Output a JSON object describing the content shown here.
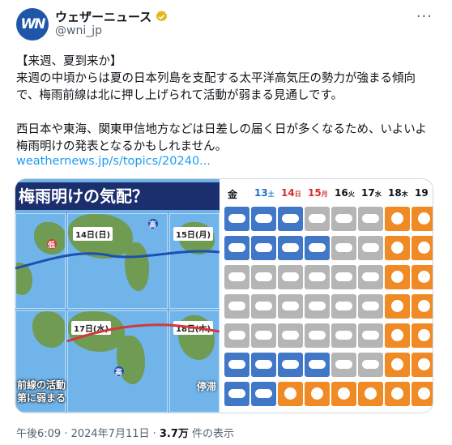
{
  "account": {
    "display_name": "ウェザーニュース",
    "handle": "@wni_jp",
    "avatar_text": "WN",
    "more_label": "···"
  },
  "post": {
    "text": "【来週、夏到来か】\n来週の中頃からは夏の日本列島を支配する太平洋高気圧の勢力が強まる傾向で、梅雨前線は北に押し上げられて活動が弱まる見通しです。\n\n西日本や東海、関東甲信地方などは日差しの届く日が多くなるため、いよいよ梅雨明けの発表となるかもしれません。",
    "link": "weathernews.jp/s/topics/20240..."
  },
  "media": {
    "left": {
      "headline": "梅雨明けの気配？",
      "maps": [
        {
          "date": "14日(日)"
        },
        {
          "date": "15日(月)"
        },
        {
          "date": "17日(水)"
        },
        {
          "date": "18日(木)"
        }
      ],
      "pressure_high": "高",
      "pressure_low": "低",
      "caption_line1": "前線の活動",
      "caption_line2": "第に弱まる",
      "stagnant": "停滞"
    },
    "right": {
      "days": [
        {
          "num": "金",
          "dow": "",
          "color": "#0f1419"
        },
        {
          "num": "13",
          "dow": "土",
          "color": "#1f6fc5"
        },
        {
          "num": "14",
          "dow": "日",
          "color": "#d0312d"
        },
        {
          "num": "15",
          "dow": "月",
          "color": "#d0312d"
        },
        {
          "num": "16",
          "dow": "火",
          "color": "#0f1419"
        },
        {
          "num": "17",
          "dow": "水",
          "color": "#0f1419"
        },
        {
          "num": "18",
          "dow": "木",
          "color": "#0f1419"
        },
        {
          "num": "19",
          "dow": "",
          "color": "#0f1419"
        }
      ],
      "rows": [
        [
          "rain",
          "rain",
          "rain",
          "cloudy",
          "cloudy",
          "cloudy",
          "sunny",
          "sunny"
        ],
        [
          "rain",
          "rain",
          "rain",
          "rain",
          "cloudy",
          "cloudy",
          "sunny",
          "sunny"
        ],
        [
          "cloudy",
          "cloudy",
          "cloudy",
          "cloudy",
          "cloudy",
          "cloudy",
          "sunny",
          "sunny"
        ],
        [
          "cloudy",
          "cloudy",
          "cloudy",
          "cloudy",
          "cloudy",
          "cloudy",
          "sunny",
          "sunny"
        ],
        [
          "cloudy",
          "cloudy",
          "cloudy",
          "cloudy",
          "cloudy",
          "cloudy",
          "sunny",
          "sunny"
        ],
        [
          "rain",
          "rain",
          "rain",
          "rain",
          "cloudy",
          "cloudy",
          "sunny",
          "sunny"
        ],
        [
          "rain",
          "rain",
          "sunny",
          "sunny",
          "sunny",
          "sunny",
          "sunny",
          "sunny"
        ]
      ]
    }
  },
  "footer": {
    "time": "午後6:09 · 2024年7月11日 · ",
    "views_count": "3.7万",
    "views_label": " 件の表示"
  }
}
